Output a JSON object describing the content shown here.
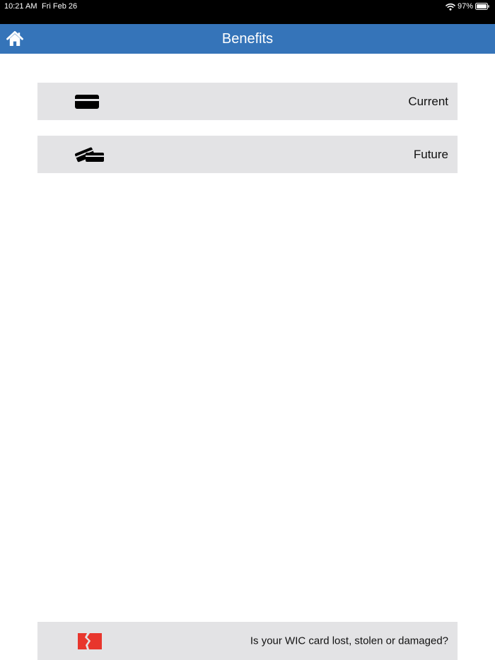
{
  "status_bar": {
    "time": "10:21 AM",
    "date": "Fri Feb 26",
    "battery_percent": "97%",
    "icons": [
      "wifi-icon",
      "battery-icon"
    ]
  },
  "nav": {
    "title": "Benefits",
    "home_icon": "home-icon",
    "color": "#3574b9"
  },
  "menu": {
    "items": [
      {
        "label": "Current",
        "icon": "credit-card-icon"
      },
      {
        "label": "Future",
        "icon": "stacked-cards-icon"
      }
    ]
  },
  "lost_card": {
    "label": "Is your WIC card lost, stolen or damaged?",
    "icon": "broken-card-icon",
    "icon_color": "#e8362d"
  }
}
